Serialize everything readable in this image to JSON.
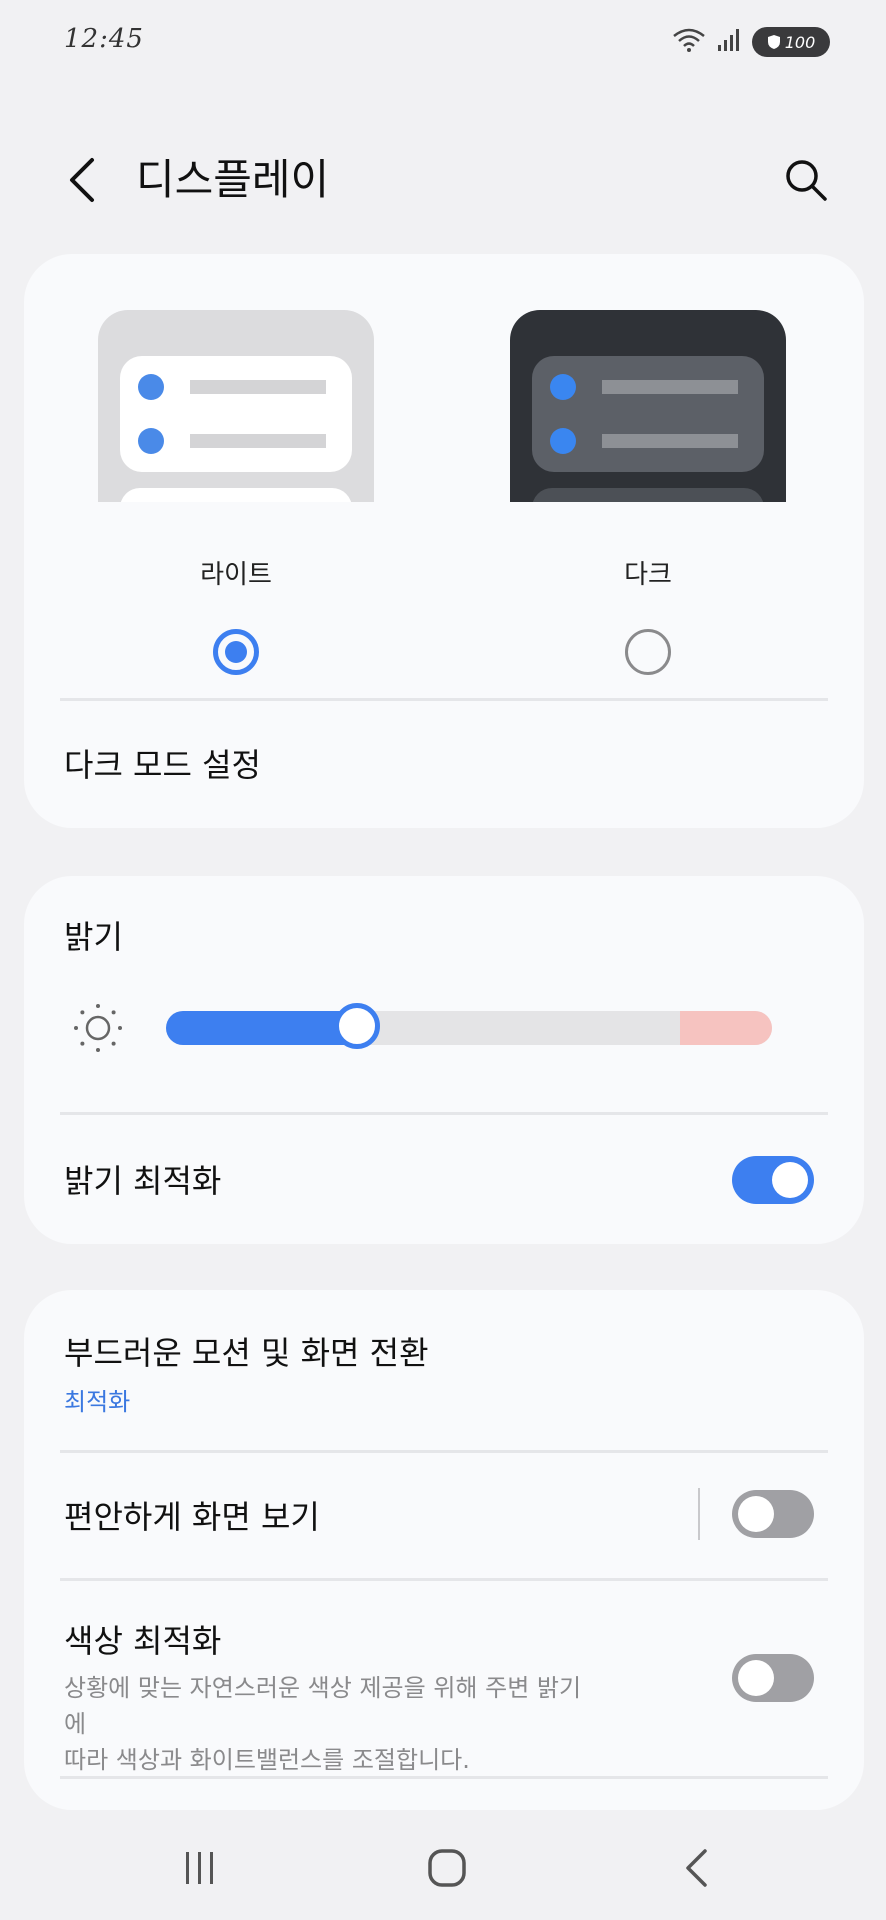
{
  "status_bar": {
    "time": "12:45",
    "battery": "100",
    "icons": [
      "wifi-icon",
      "signal-icon",
      "battery-icon"
    ]
  },
  "header": {
    "title": "디스플레이",
    "back_icon": "chevron-left-icon",
    "search_icon": "search-icon"
  },
  "theme": {
    "options": [
      {
        "label": "라이트",
        "selected": true
      },
      {
        "label": "다크",
        "selected": false
      }
    ],
    "dark_mode_settings": "다크 모드 설정"
  },
  "brightness": {
    "title": "밝기",
    "level": 0.3,
    "adaptive_label": "밝기 최적화",
    "adaptive_on": true
  },
  "motion": {
    "title": "부드러운 모션 및 화면 전환",
    "value": "최적화"
  },
  "eye_comfort": {
    "title": "편안하게 화면 보기",
    "on": false
  },
  "color_optimize": {
    "title": "색상 최적화",
    "description_line1": "상황에 맞는 자연스러운 색상 제공을 위해 주변 밝기에",
    "description_line2": "따라 색상과 화이트밸런스를 조절합니다.",
    "on": false
  },
  "colors": {
    "accent": "#3d7ff0",
    "background": "#f1f1f3",
    "card": "#f9fafc"
  },
  "navbar": {
    "icons": [
      "recent-apps-icon",
      "home-icon",
      "back-icon"
    ]
  }
}
